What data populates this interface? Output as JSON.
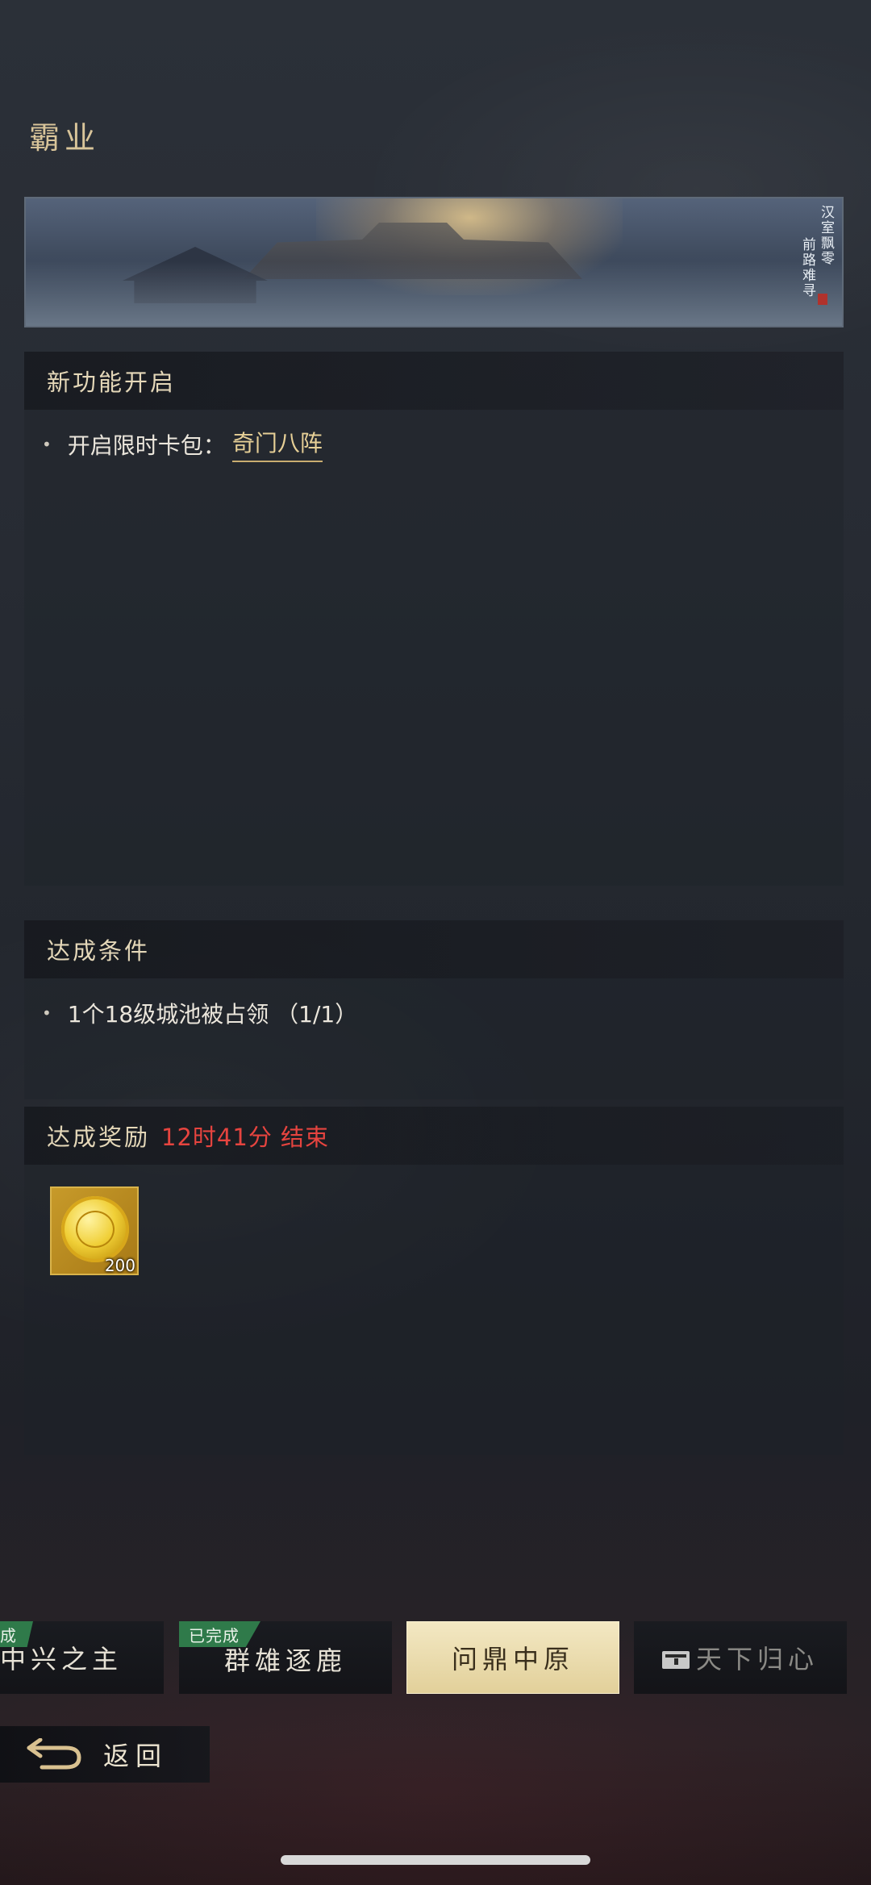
{
  "header": {
    "title": "霸业"
  },
  "banner": {
    "poem_col1": "汉室飘零",
    "poem_col2": "前路难寻"
  },
  "new_feature": {
    "heading": "新功能开启",
    "item_prefix": "开启限时卡包：",
    "item_link": "奇门八阵"
  },
  "conditions": {
    "heading": "达成条件",
    "item": "1个18级城池被占领 （1/1）"
  },
  "rewards": {
    "heading": "达成奖励",
    "timer": "12时41分 结束",
    "items": [
      {
        "icon": "gold-coin-icon",
        "quantity": "200"
      }
    ]
  },
  "tabs": [
    {
      "label": "中兴之主",
      "badge": "成",
      "state": "completed"
    },
    {
      "label": "群雄逐鹿",
      "badge": "已完成",
      "state": "completed"
    },
    {
      "label": "问鼎中原",
      "state": "active"
    },
    {
      "label": "天下归心",
      "state": "locked"
    }
  ],
  "footer": {
    "back_label": "返回"
  },
  "colors": {
    "accent_gold": "#e6cf96",
    "timer_red": "#e6443f",
    "badge_green": "#2f7a4a"
  }
}
